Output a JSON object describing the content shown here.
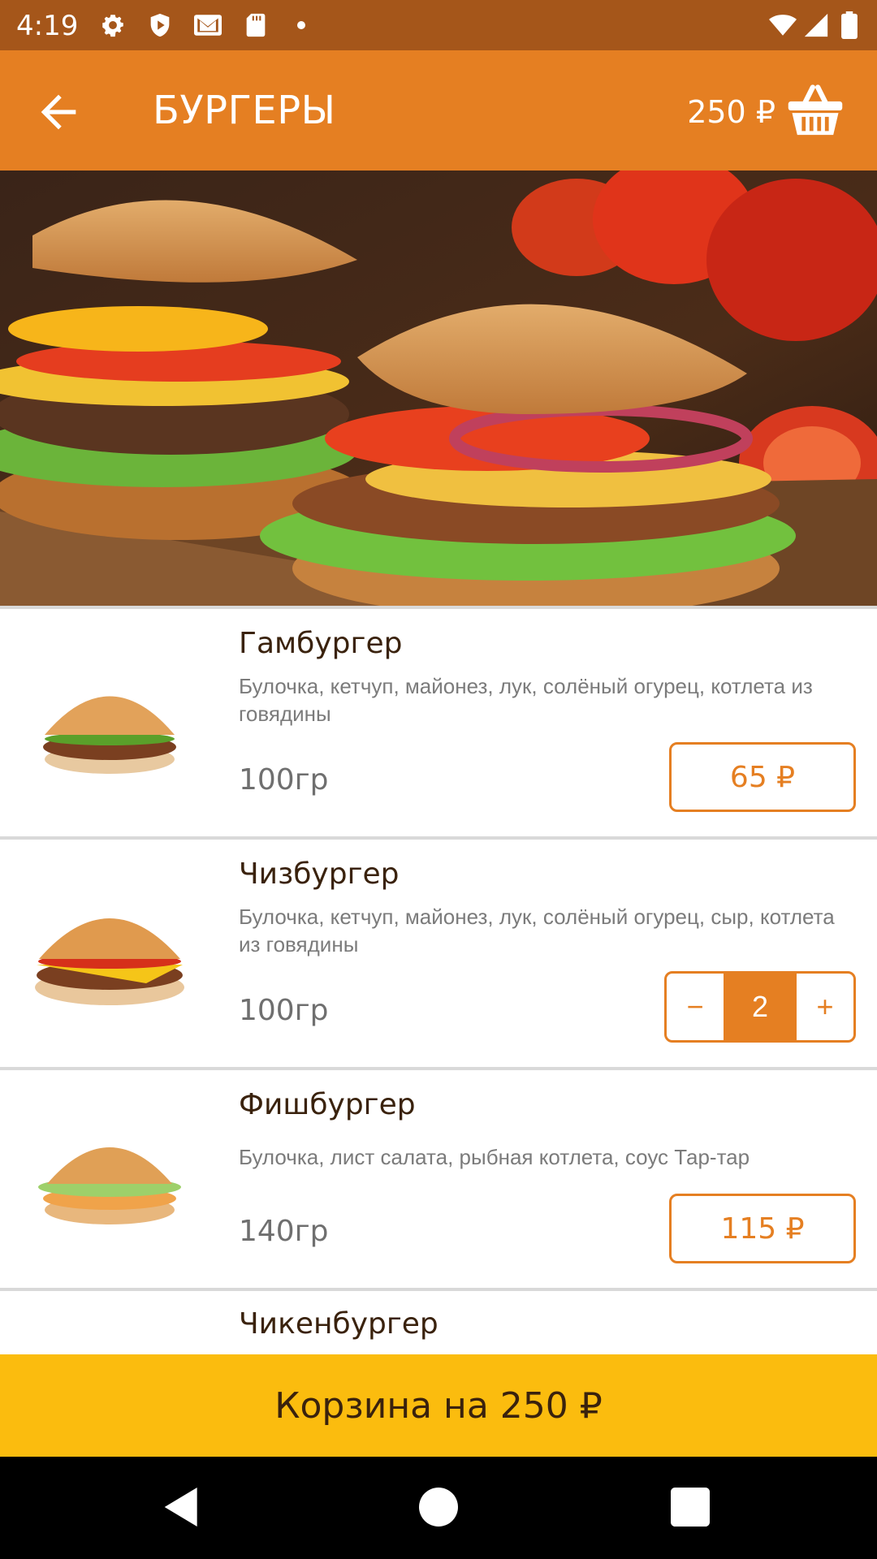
{
  "status_bar": {
    "time": "4:19"
  },
  "app_bar": {
    "title": "БУРГЕРЫ",
    "cart_total": "250 ₽"
  },
  "items": [
    {
      "name": "Гамбургер",
      "description": "Булочка, кетчуп, майонез, лук, солёный огурец, котлета из говядины",
      "weight": "100гр",
      "price": "65 ₽"
    },
    {
      "name": "Чизбургер",
      "description": "Булочка, кетчуп, майонез, лук, солёный огурец, сыр, котлета из говядины",
      "weight": "100гр",
      "quantity": "2",
      "minus": "−",
      "plus": "+"
    },
    {
      "name": "Фишбургер",
      "description": "Булочка, лист салата, рыбная котлета, соус Тар-тар",
      "weight": "140гр",
      "price": "115 ₽"
    },
    {
      "name": "Чикенбургер"
    }
  ],
  "cart_bar": {
    "label": "Корзина на 250 ₽"
  },
  "colors": {
    "status_bar": "#a5561a",
    "app_bar": "#e57f22",
    "accent": "#e57f22",
    "cart_bar": "#fbbc0e",
    "title_text": "#3a220d"
  },
  "icons": [
    "settings-icon",
    "shield-icon",
    "mail-icon",
    "sd-card-icon",
    "wifi-icon",
    "signal-icon",
    "battery-icon",
    "back-arrow-icon",
    "basket-icon",
    "nav-back-icon",
    "nav-home-icon",
    "nav-recents-icon"
  ]
}
